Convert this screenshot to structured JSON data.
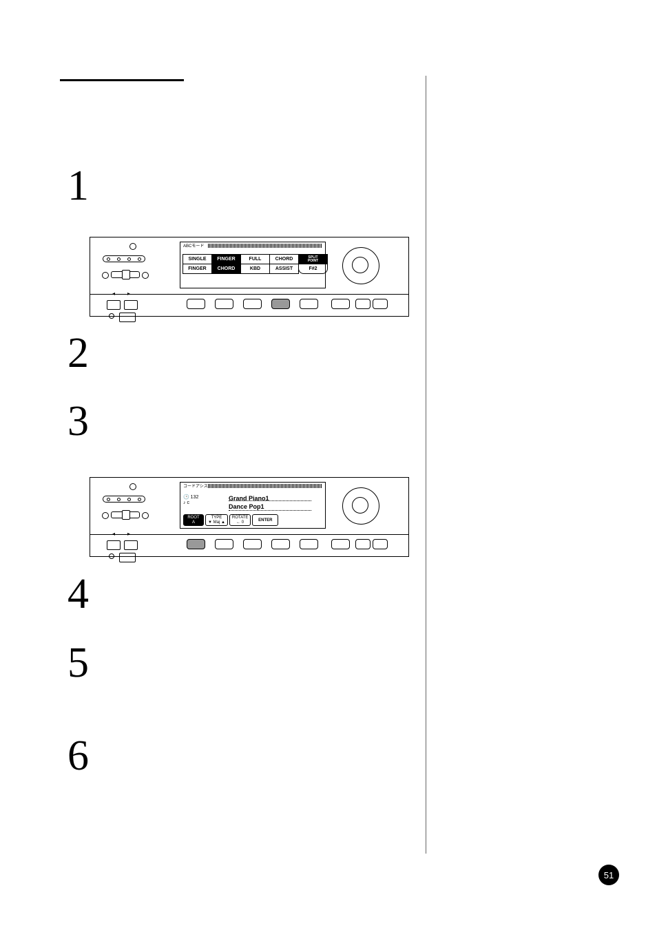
{
  "page_number": "51",
  "steps": [
    "1",
    "2",
    "3",
    "4",
    "5",
    "6"
  ],
  "panelA": {
    "lcd_header": "ABCモード",
    "grid": {
      "r1": [
        "SINGLE",
        "FINGER",
        "FULL",
        "CHORD",
        "SPLIT"
      ],
      "r2": [
        "FINGER",
        "CHORD",
        "KBD",
        "ASSIST",
        "F#2"
      ],
      "r1_inv": [
        false,
        true,
        false,
        false,
        false
      ],
      "r2_inv": [
        false,
        true,
        false,
        false,
        false
      ],
      "split_top": "SPLIT",
      "split_sub": "POINT"
    }
  },
  "panelB": {
    "lcd_header": "コードアシスト",
    "tempo": "132",
    "beat_note": "c",
    "voice": "Grand Piano1",
    "style": "Dance Pop1",
    "frow": [
      {
        "top": "ROOT",
        "bot": "A",
        "inv": true
      },
      {
        "top": "TYPE",
        "bot": "▼ Maj ▲",
        "inv": false
      },
      {
        "top": "ROTATE",
        "bot": "← 0",
        "inv": false
      },
      {
        "top": "ENTER",
        "bot": "",
        "inv": false
      }
    ]
  },
  "panelA_dark_index": 3,
  "panelB_dark_index": 0
}
